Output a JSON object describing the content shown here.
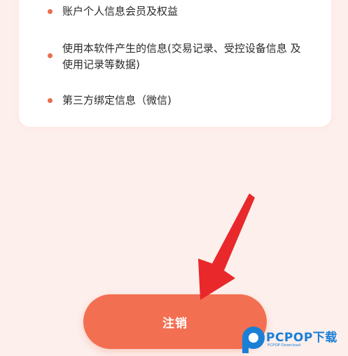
{
  "info_items": [
    {
      "text": "账户个人信息会员及权益"
    },
    {
      "text": "使用本软件产生的信息(交易记录、受控设备信息 及 使用记录等数据)"
    },
    {
      "text": "第三方绑定信息（微信)"
    }
  ],
  "cancel_button": {
    "label": "注销"
  },
  "watermark": {
    "brand": "PCPOP下载",
    "sub": "PCPOP Download"
  },
  "colors": {
    "accent": "#f36f51",
    "bullet": "#e86e4f",
    "background": "#fdefec",
    "arrow": "#e8282a",
    "watermark": "#1a7fd6"
  }
}
